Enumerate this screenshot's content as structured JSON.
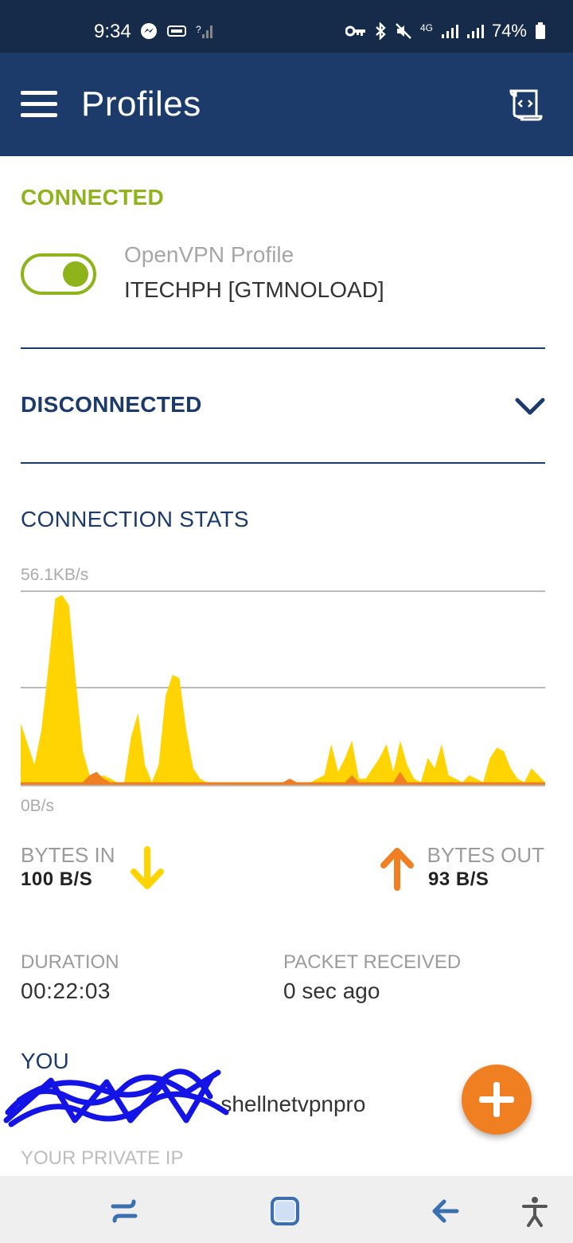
{
  "status_bar": {
    "time": "9:34",
    "signal_label": "4G",
    "battery": "74%"
  },
  "app_bar": {
    "title": "Profiles"
  },
  "connected_section": {
    "heading": "CONNECTED",
    "profile_type": "OpenVPN Profile",
    "profile_name": "ITECHPH [GTMNOLOAD]",
    "toggle_on": true
  },
  "disconnected_section": {
    "heading": "DISCONNECTED"
  },
  "stats": {
    "heading": "CONNECTION STATS",
    "max_label": "56.1KB/s",
    "min_label": "0B/s",
    "bytes_in_label": "BYTES IN",
    "bytes_in_value": "100 B/S",
    "bytes_out_label": "BYTES OUT",
    "bytes_out_value": "93 B/S",
    "duration_label": "DURATION",
    "duration_value": "00:22:03",
    "packet_label": "PACKET RECEIVED",
    "packet_value": "0 sec ago",
    "you_label": "YOU",
    "you_value": "-shellnetvpnpro",
    "private_ip_label": "YOUR PRIVATE IP"
  },
  "chart_data": {
    "type": "area",
    "ylim": [
      0,
      56.1
    ],
    "ylabel_max": "56.1KB/s",
    "ylabel_min": "0B/s",
    "grid": true,
    "series": [
      {
        "color": "#ffd400",
        "values": [
          18,
          12,
          6,
          16,
          34,
          54,
          55,
          52,
          30,
          10,
          3,
          2,
          3,
          2,
          1,
          1,
          14,
          21,
          6,
          1,
          6,
          26,
          32,
          31,
          16,
          5,
          2,
          1,
          1,
          1,
          1,
          1,
          1,
          1,
          1,
          1,
          1,
          1,
          1,
          1,
          1,
          1,
          1,
          2,
          3,
          12,
          4,
          8,
          13,
          2,
          2,
          5,
          8,
          12,
          4,
          13,
          6,
          2,
          1,
          8,
          5,
          12,
          3,
          2,
          1,
          3,
          2,
          1,
          8,
          11,
          10,
          5,
          2,
          1,
          5,
          3,
          1
        ],
        "unit": "KB/s"
      },
      {
        "color": "#f07f22",
        "values": [
          1,
          1,
          1,
          1,
          1,
          1,
          1,
          1,
          1,
          1,
          3,
          4,
          2,
          1,
          1,
          1,
          1,
          1,
          1,
          1,
          1,
          1,
          1,
          1,
          1,
          1,
          1,
          1,
          1,
          1,
          1,
          1,
          1,
          1,
          1,
          1,
          1,
          1,
          1,
          2,
          1,
          1,
          1,
          1,
          1,
          1,
          1,
          1,
          3,
          1,
          1,
          1,
          1,
          1,
          1,
          4,
          1,
          1,
          1,
          1,
          1,
          1,
          1,
          1,
          1,
          1,
          1,
          1,
          1,
          1,
          1,
          1,
          1,
          1,
          1,
          1,
          1
        ],
        "unit": "KB/s"
      }
    ]
  },
  "colors": {
    "primary": "#1c3b6b",
    "connected": "#8fb31a",
    "bytes_in": "#ffd400",
    "bytes_out": "#f07f22",
    "fab": "#f07f22"
  }
}
